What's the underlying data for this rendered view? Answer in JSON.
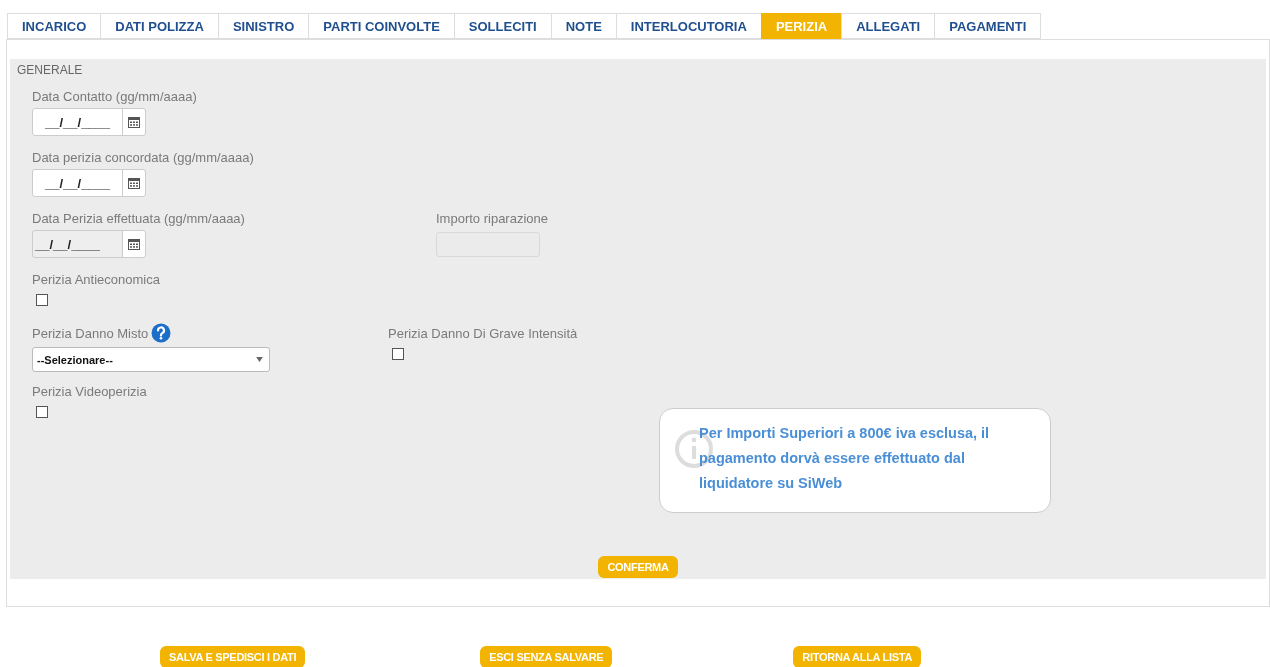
{
  "tabs": [
    {
      "label": "INCARICO",
      "selected": false
    },
    {
      "label": "DATI POLIZZA",
      "selected": false
    },
    {
      "label": "SINISTRO",
      "selected": false
    },
    {
      "label": "PARTI COINVOLTE",
      "selected": false
    },
    {
      "label": "SOLLECITI",
      "selected": false
    },
    {
      "label": "NOTE",
      "selected": false
    },
    {
      "label": "INTERLOCUTORIA",
      "selected": false
    },
    {
      "label": "PERIZIA",
      "selected": true
    },
    {
      "label": "ALLEGATI",
      "selected": false
    },
    {
      "label": "PAGAMENTI",
      "selected": false
    }
  ],
  "section": {
    "title": "GENERALE",
    "rows": [
      [
        {
          "kind": "date",
          "label": "Data Contatto (gg/mm/aaaa)",
          "value": "__/__/____",
          "disabled": false
        }
      ],
      [
        {
          "kind": "date",
          "label": "Data perizia concordata (gg/mm/aaaa)",
          "value": "__/__/____",
          "disabled": false
        }
      ],
      [
        {
          "kind": "date",
          "label": "Data Perizia effettuata (gg/mm/aaaa)",
          "value": "__/__/____",
          "disabled": true
        },
        {
          "kind": "amount",
          "label": "Importo riparazione",
          "disabled": true
        }
      ],
      [
        {
          "kind": "checkbox",
          "label": "Perizia Antieconomica",
          "checked": false
        }
      ],
      [
        {
          "kind": "select",
          "label": "Perizia Danno Misto",
          "help": true,
          "value": "--Selezionare--"
        },
        {
          "kind": "checkbox",
          "label": "Perizia Danno Di Grave Intensità",
          "checked": false
        }
      ],
      [
        {
          "kind": "checkbox",
          "label": "Perizia Videoperizia",
          "checked": false
        }
      ]
    ],
    "notice": "Per Importi Superiori a 800€ iva esclusa, il pagamento dorvà essere effettuato dal liquidatore su SiWeb",
    "confirm": "CONFERMA"
  },
  "actions": [
    "SALVA E SPEDISCI I DATI",
    "ESCI SENZA SALVARE",
    "RITORNA ALLA LISTA"
  ]
}
